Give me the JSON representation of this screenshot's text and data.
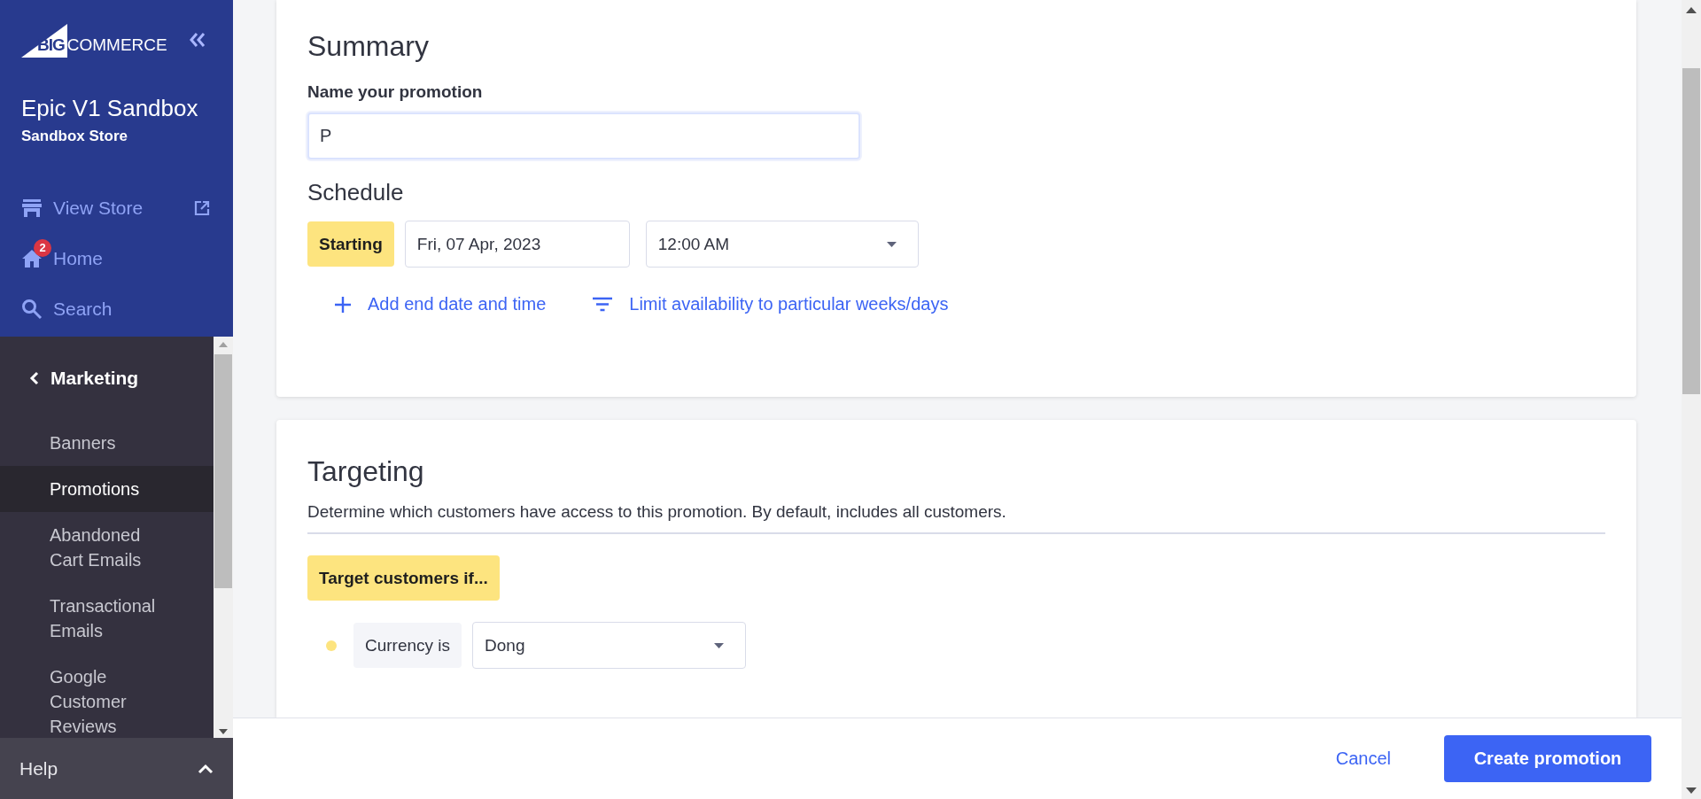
{
  "sidebar": {
    "logo": {
      "text_bold": "BIG",
      "text": "COMMERCE"
    },
    "store_name": "Epic V1 Sandbox",
    "store_type": "Sandbox Store",
    "top_links": [
      {
        "kind": "store",
        "label": "View Store"
      },
      {
        "kind": "home",
        "label": "Home",
        "badge": "2"
      },
      {
        "kind": "search",
        "label": "Search"
      }
    ],
    "section": "Marketing",
    "items": [
      {
        "label": "Banners",
        "selected": false
      },
      {
        "label": "Promotions",
        "selected": true
      },
      {
        "label": "Abandoned Cart Emails",
        "selected": false
      },
      {
        "label": "Transactional Emails",
        "selected": false
      },
      {
        "label": "Google Customer Reviews",
        "selected": false
      }
    ],
    "help": "Help"
  },
  "summary": {
    "title": "Summary",
    "name_label": "Name your promotion",
    "name_value": "P",
    "schedule_title": "Schedule",
    "starting_label": "Starting",
    "date": "Fri, 07 Apr, 2023",
    "time": "12:00 AM",
    "links": [
      {
        "kind": "add",
        "label": "Add end date and time"
      },
      {
        "kind": "filter",
        "label": "Limit availability to particular weeks/days"
      }
    ]
  },
  "targeting": {
    "title": "Targeting",
    "description": "Determine which customers have access to this promotion. By default, includes all customers.",
    "condition_label": "Target customers if...",
    "conditions": [
      {
        "label": "Currency is",
        "value": "Dong",
        "color": "#fde47f"
      }
    ]
  },
  "footer": {
    "cancel": "Cancel",
    "submit": "Create promotion"
  }
}
